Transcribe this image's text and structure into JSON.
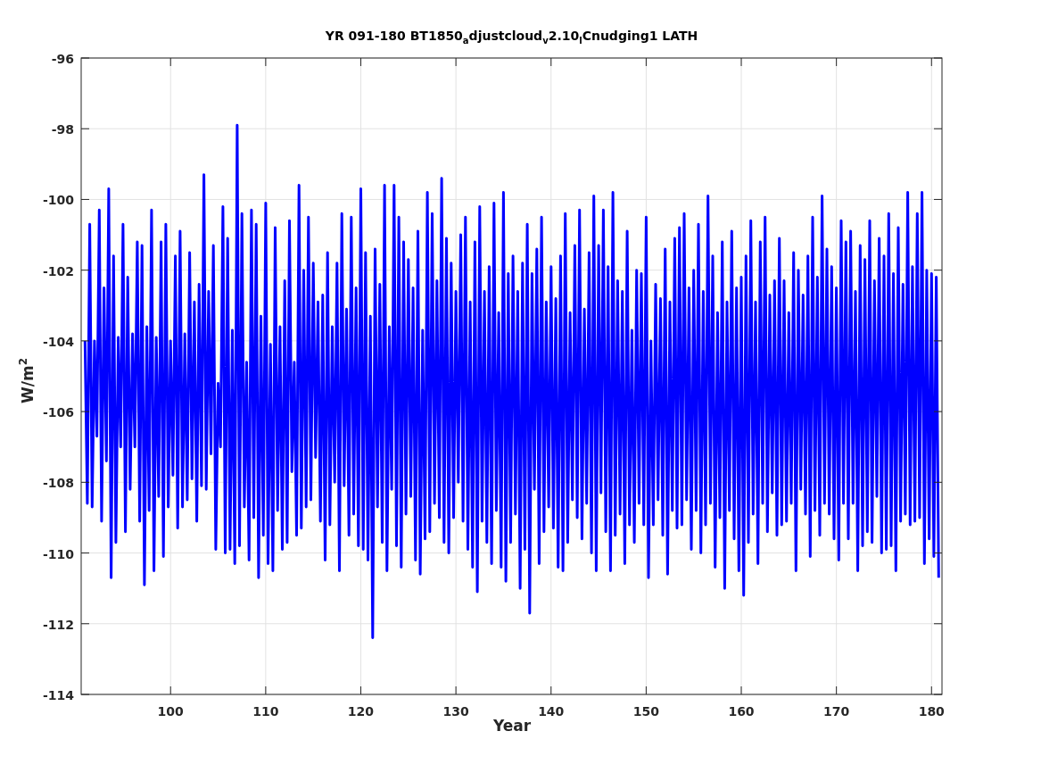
{
  "figure": {
    "chart_data": {
      "type": "line",
      "title": "YR 091-180 BT1850$_{a}$djustcloud$_{v}$2.10$_{l}$Cnudging1 LATH",
      "xlabel": "Year",
      "ylabel": "W/m$^{2}$",
      "xlim": [
        90.6,
        181.1
      ],
      "ylim": [
        -114,
        -96
      ],
      "grid": true,
      "xticks": [
        100,
        110,
        120,
        130,
        140,
        150,
        160,
        170,
        180
      ],
      "yticks": [
        -114,
        -112,
        -110,
        -108,
        -106,
        -104,
        -102,
        -100,
        -98,
        -96
      ],
      "x": [
        91,
        91.25,
        91.5,
        91.75,
        92,
        92.25,
        92.5,
        92.75,
        93,
        93.25,
        93.5,
        93.75,
        94,
        94.25,
        94.5,
        94.75,
        95,
        95.25,
        95.5,
        95.75,
        96,
        96.25,
        96.5,
        96.75,
        97,
        97.25,
        97.5,
        97.75,
        98,
        98.25,
        98.5,
        98.75,
        99,
        99.25,
        99.5,
        99.75,
        100,
        100.25,
        100.5,
        100.75,
        101,
        101.25,
        101.5,
        101.75,
        102,
        102.25,
        102.5,
        102.75,
        103,
        103.25,
        103.5,
        103.75,
        104,
        104.25,
        104.5,
        104.75,
        105,
        105.25,
        105.5,
        105.75,
        106,
        106.25,
        106.5,
        106.75,
        107,
        107.25,
        107.5,
        107.75,
        108,
        108.25,
        108.5,
        108.75,
        109,
        109.25,
        109.5,
        109.75,
        110,
        110.25,
        110.5,
        110.75,
        111,
        111.25,
        111.5,
        111.75,
        112,
        112.25,
        112.5,
        112.75,
        113,
        113.25,
        113.5,
        113.75,
        114,
        114.25,
        114.5,
        114.75,
        115,
        115.25,
        115.5,
        115.75,
        116,
        116.25,
        116.5,
        116.75,
        117,
        117.25,
        117.5,
        117.75,
        118,
        118.25,
        118.5,
        118.75,
        119,
        119.25,
        119.5,
        119.75,
        120,
        120.25,
        120.5,
        120.75,
        121,
        121.25,
        121.5,
        121.75,
        122,
        122.25,
        122.5,
        122.75,
        123,
        123.25,
        123.5,
        123.75,
        124,
        124.25,
        124.5,
        124.75,
        125,
        125.25,
        125.5,
        125.75,
        126,
        126.25,
        126.5,
        126.75,
        127,
        127.25,
        127.5,
        127.75,
        128,
        128.25,
        128.5,
        128.75,
        129,
        129.25,
        129.5,
        129.75,
        130,
        130.25,
        130.5,
        130.75,
        131,
        131.25,
        131.5,
        131.75,
        132,
        132.25,
        132.5,
        132.75,
        133,
        133.25,
        133.5,
        133.75,
        134,
        134.25,
        134.5,
        134.75,
        135,
        135.25,
        135.5,
        135.75,
        136,
        136.25,
        136.5,
        136.75,
        137,
        137.25,
        137.5,
        137.75,
        138,
        138.25,
        138.5,
        138.75,
        139,
        139.25,
        139.5,
        139.75,
        140,
        140.25,
        140.5,
        140.75,
        141,
        141.25,
        141.5,
        141.75,
        142,
        142.25,
        142.5,
        142.75,
        143,
        143.25,
        143.5,
        143.75,
        144,
        144.25,
        144.5,
        144.75,
        145,
        145.25,
        145.5,
        145.75,
        146,
        146.25,
        146.5,
        146.75,
        147,
        147.25,
        147.5,
        147.75,
        148,
        148.25,
        148.5,
        148.75,
        149,
        149.25,
        149.5,
        149.75,
        150,
        150.25,
        150.5,
        150.75,
        151,
        151.25,
        151.5,
        151.75,
        152,
        152.25,
        152.5,
        152.75,
        153,
        153.25,
        153.5,
        153.75,
        154,
        154.25,
        154.5,
        154.75,
        155,
        155.25,
        155.5,
        155.75,
        156,
        156.25,
        156.5,
        156.75,
        157,
        157.25,
        157.5,
        157.75,
        158,
        158.25,
        158.5,
        158.75,
        159,
        159.25,
        159.5,
        159.75,
        160,
        160.25,
        160.5,
        160.75,
        161,
        161.25,
        161.5,
        161.75,
        162,
        162.25,
        162.5,
        162.75,
        163,
        163.25,
        163.5,
        163.75,
        164,
        164.25,
        164.5,
        164.75,
        165,
        165.25,
        165.5,
        165.75,
        166,
        166.25,
        166.5,
        166.75,
        167,
        167.25,
        167.5,
        167.75,
        168,
        168.25,
        168.5,
        168.75,
        169,
        169.25,
        169.5,
        169.75,
        170,
        170.25,
        170.5,
        170.75,
        171,
        171.25,
        171.5,
        171.75,
        172,
        172.25,
        172.5,
        172.75,
        173,
        173.25,
        173.5,
        173.75,
        174,
        174.25,
        174.5,
        174.75,
        175,
        175.25,
        175.5,
        175.75,
        176,
        176.25,
        176.5,
        176.75,
        177,
        177.25,
        177.5,
        177.75,
        178,
        178.25,
        178.5,
        178.75,
        179,
        179.25,
        179.5,
        179.75,
        180,
        180.25,
        180.5,
        180.75
      ],
      "series": [
        {
          "color": "#0000ff",
          "values": [
            -104,
            -108.6,
            -100.7,
            -108.7,
            -104,
            -106.7,
            -100.3,
            -109.1,
            -102.5,
            -107.4,
            -99.7,
            -110.7,
            -101.6,
            -109.7,
            -103.9,
            -107,
            -100.7,
            -109.4,
            -102.2,
            -108.2,
            -103.8,
            -107,
            -101.2,
            -109.1,
            -101.3,
            -110.9,
            -103.6,
            -108.8,
            -100.3,
            -110.5,
            -103.9,
            -108.4,
            -101.2,
            -110.1,
            -100.7,
            -108.7,
            -104,
            -107.8,
            -101.6,
            -109.3,
            -100.9,
            -108.7,
            -103.8,
            -108.5,
            -101.5,
            -107.9,
            -102.9,
            -109.1,
            -102.4,
            -108.1,
            -99.3,
            -108.2,
            -102.6,
            -107.2,
            -101.3,
            -109.9,
            -105.2,
            -107,
            -100.2,
            -110,
            -101.1,
            -109.9,
            -103.7,
            -110.3,
            -97.9,
            -109.8,
            -100.4,
            -108.7,
            -104.6,
            -110.2,
            -100.3,
            -109,
            -100.7,
            -110.7,
            -103.3,
            -109.5,
            -100.1,
            -110.3,
            -104.1,
            -110.5,
            -100.8,
            -108.8,
            -103.6,
            -109.9,
            -102.3,
            -109.7,
            -100.6,
            -107.7,
            -104.6,
            -109.5,
            -99.6,
            -109.3,
            -102,
            -108.7,
            -100.5,
            -108.5,
            -101.8,
            -107.3,
            -102.9,
            -109.1,
            -102.7,
            -110.2,
            -101.5,
            -109.2,
            -103.6,
            -108,
            -101.8,
            -110.5,
            -100.4,
            -108.1,
            -103.1,
            -109.5,
            -100.5,
            -108.9,
            -102.5,
            -109.8,
            -99.7,
            -109.9,
            -101.5,
            -110.2,
            -103.3,
            -112.4,
            -101.4,
            -108.7,
            -102.4,
            -109.7,
            -99.6,
            -110.5,
            -103.6,
            -108.2,
            -99.6,
            -109.8,
            -100.5,
            -110.4,
            -101.2,
            -108.9,
            -101.7,
            -108.4,
            -102.5,
            -110.2,
            -100.9,
            -110.6,
            -103.7,
            -109.6,
            -99.8,
            -109.4,
            -100.4,
            -108.6,
            -102.3,
            -109,
            -99.4,
            -109.7,
            -101.1,
            -110,
            -101.8,
            -109,
            -102.6,
            -108,
            -101,
            -109.1,
            -100.5,
            -109.9,
            -102.9,
            -110.4,
            -101.2,
            -111.1,
            -100.2,
            -109.1,
            -102.6,
            -109.7,
            -101.9,
            -110.3,
            -100.1,
            -108.8,
            -103.2,
            -110.4,
            -99.8,
            -110.8,
            -102.1,
            -109.7,
            -101.6,
            -108.9,
            -102.6,
            -111,
            -101.8,
            -109.9,
            -100.7,
            -111.7,
            -102.1,
            -108.2,
            -101.4,
            -110.3,
            -100.5,
            -109.4,
            -102.9,
            -108.7,
            -101.9,
            -109.3,
            -102.8,
            -110.4,
            -101.6,
            -110.5,
            -100.4,
            -109.7,
            -103.2,
            -108.5,
            -101.3,
            -109,
            -100.3,
            -109.6,
            -103.1,
            -108.6,
            -101.5,
            -110,
            -99.9,
            -110.5,
            -101.3,
            -108.3,
            -100.3,
            -109.4,
            -101.9,
            -110.5,
            -99.8,
            -109.5,
            -102.3,
            -108.9,
            -102.6,
            -110.3,
            -100.9,
            -109.2,
            -103.7,
            -109.7,
            -102,
            -108.6,
            -102.1,
            -109.2,
            -100.5,
            -110.7,
            -104,
            -109.2,
            -102.4,
            -108.5,
            -102.8,
            -109.5,
            -101.4,
            -110.6,
            -102.9,
            -108.8,
            -101.1,
            -109.3,
            -100.8,
            -109.2,
            -100.4,
            -108.5,
            -102.5,
            -109.9,
            -102,
            -108.8,
            -100.7,
            -110,
            -102.6,
            -109.2,
            -99.9,
            -108.6,
            -101.6,
            -110.4,
            -103.2,
            -109,
            -101.2,
            -111,
            -102.9,
            -108.8,
            -100.9,
            -109.6,
            -102.5,
            -110.5,
            -102.2,
            -111.2,
            -101.6,
            -109.7,
            -100.6,
            -108.9,
            -102.9,
            -110.3,
            -101.2,
            -108.6,
            -100.5,
            -109.4,
            -102.7,
            -108.3,
            -102.3,
            -109.5,
            -101.1,
            -109.2,
            -102.3,
            -109.1,
            -103.2,
            -108.6,
            -101.5,
            -110.5,
            -102,
            -108.2,
            -102.7,
            -108.9,
            -101.6,
            -110.1,
            -100.5,
            -108.8,
            -102.2,
            -109.5,
            -99.9,
            -108.6,
            -101.4,
            -108.9,
            -101.9,
            -109.6,
            -102.5,
            -110.2,
            -100.6,
            -108.6,
            -101.2,
            -109.6,
            -100.9,
            -108.6,
            -102.6,
            -110.5,
            -101.3,
            -109.8,
            -101.7,
            -109.4,
            -100.6,
            -109.7,
            -102.3,
            -108.4,
            -101.1,
            -110,
            -101.6,
            -109.9,
            -100.4,
            -109.8,
            -102.1,
            -110.5,
            -100.8,
            -109.1,
            -102.4,
            -108.9,
            -99.8,
            -109.2,
            -101.9,
            -109.1,
            -100.4,
            -109,
            -99.8,
            -110.3,
            -102,
            -109.6,
            -102.1,
            -110.1,
            -102.2,
            -110.7
          ]
        }
      ]
    }
  }
}
